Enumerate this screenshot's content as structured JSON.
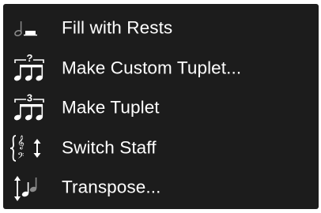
{
  "menu": {
    "items": [
      {
        "label": "Fill with Rests",
        "icon": "fill-with-rests-icon"
      },
      {
        "label": "Make Custom Tuplet...",
        "icon": "custom-tuplet-icon"
      },
      {
        "label": "Make Tuplet",
        "icon": "tuplet-icon"
      },
      {
        "label": "Switch Staff",
        "icon": "switch-staff-icon"
      },
      {
        "label": "Transpose...",
        "icon": "transpose-icon"
      }
    ]
  },
  "colors": {
    "menu_background": "#1c1c1c",
    "text": "#ffffff",
    "icon_dim": "#8a8a8a"
  }
}
